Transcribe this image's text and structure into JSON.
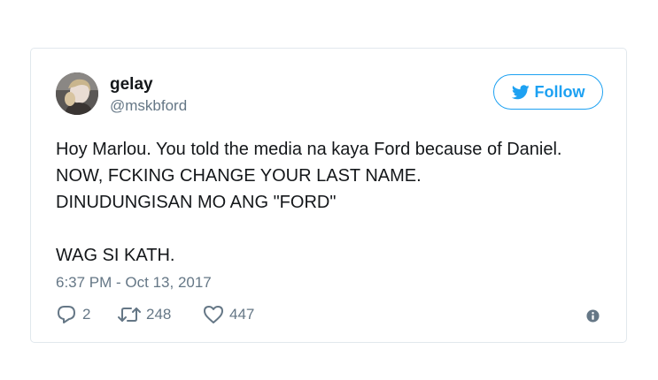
{
  "tweet": {
    "user": {
      "name": "gelay",
      "handle": "@mskbford",
      "avatar_icon": "profile-photo"
    },
    "follow_label": "Follow",
    "text_lines": [
      "Hoy Marlou. You told the media na kaya Ford because of Daniel.",
      "NOW, FCKING CHANGE YOUR LAST NAME.",
      "DINUDUNGISAN MO ANG \"FORD\"",
      "",
      "WAG SI KATH."
    ],
    "timestamp": "6:37 PM - Oct 13, 2017",
    "stats": {
      "replies": "2",
      "retweets": "248",
      "likes": "447"
    }
  },
  "colors": {
    "accent": "#1da1f2",
    "muted": "#657786",
    "text": "#14171a",
    "border": "#e1e8ed"
  }
}
